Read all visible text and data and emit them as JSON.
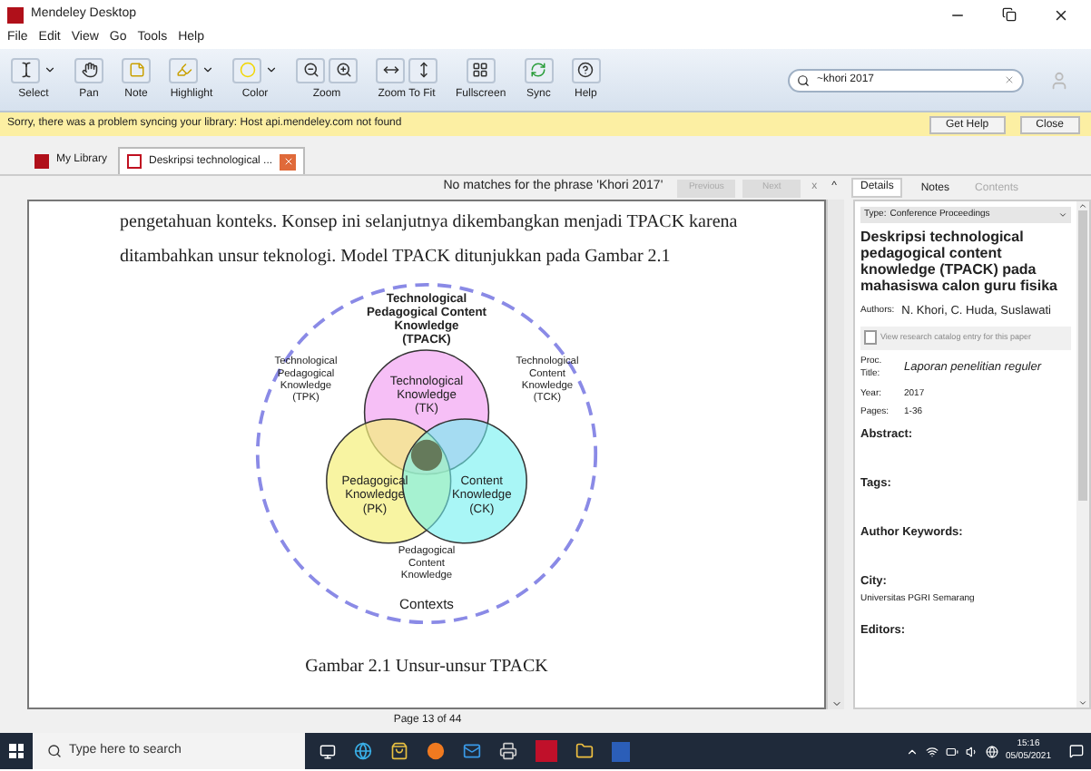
{
  "window": {
    "title": "Mendeley Desktop"
  },
  "menu": [
    "File",
    "Edit",
    "View",
    "Go",
    "Tools",
    "Help"
  ],
  "toolbar": [
    {
      "label": "Select",
      "has_menu": true
    },
    {
      "label": "Pan",
      "has_menu": false
    },
    {
      "label": "Note",
      "has_menu": false
    },
    {
      "label": "Highlight",
      "has_menu": true
    },
    {
      "label": "Color",
      "has_menu": true
    },
    {
      "label": "Zoom",
      "has_menu": false
    },
    {
      "label": "Zoom To Fit",
      "has_menu": false
    },
    {
      "label": "Fullscreen",
      "has_menu": false
    },
    {
      "label": "Sync",
      "has_menu": false
    },
    {
      "label": "Help",
      "has_menu": false
    }
  ],
  "search": {
    "value": "~khori 2017"
  },
  "notification": {
    "message": "Sorry, there was a problem syncing your library: Host api.mendeley.com not found",
    "buttons": [
      "Get Help",
      "Close"
    ]
  },
  "tabs": [
    {
      "label": "My Library",
      "selected": false,
      "closable": false
    },
    {
      "label": "Deskripsi technological ...",
      "selected": true,
      "closable": true
    }
  ],
  "find_bar": {
    "message": "No matches for the phrase 'Khori 2017'",
    "buttons": [
      {
        "label": "Previous",
        "disabled": true
      },
      {
        "label": "Next",
        "disabled": true
      }
    ],
    "close": "x",
    "collapse": "^"
  },
  "document": {
    "lines": [
      "pengetahuan konteks. Konsep ini selanjutnya dikembangkan menjadi TPACK karena",
      "ditambahkan unsur teknologi. Model TPACK ditunjukkan pada Gambar 2.1"
    ],
    "figure_labels": [
      [
        "Technological",
        "Pedagogical Content",
        "Knowledge",
        "(TPACK)"
      ],
      [
        "Technological",
        "Pedagogical",
        "Knowledge",
        "(TPK)"
      ],
      [
        "Technological",
        "Knowledge",
        "(TK)"
      ],
      [
        "Technological",
        "Content",
        "Knowledge",
        "(TCK)"
      ],
      [
        "Pedagogical",
        "Knowledge",
        "(PK)"
      ],
      [
        "Content",
        "Knowledge",
        "(CK)"
      ],
      [
        "Pedagogical",
        "Content",
        "Knowledge"
      ],
      [
        "Contexts"
      ]
    ],
    "caption": "Gambar 2.1 Unsur-unsur TPACK",
    "page": "Page 13 of 44"
  },
  "panel_tabs": [
    {
      "label": "Details",
      "selected": true,
      "disabled": false
    },
    {
      "label": "Notes",
      "selected": false,
      "disabled": false
    },
    {
      "label": "Contents",
      "selected": false,
      "disabled": true
    }
  ],
  "details": {
    "type_label": "Type:",
    "type_value": "Conference Proceedings",
    "title": "Deskripsi technological pedagogical content knowledge (TPACK) pada mahasiswa calon guru fisika",
    "authors_label": "Authors:",
    "authors": "N. Khori, C. Huda, Suslawati",
    "catalog_button": "View research catalog entry for this paper",
    "fields": [
      {
        "label": "Proc. Title:",
        "value": "Laporan penelitian reguler",
        "italic": true
      },
      {
        "label": "Year:",
        "value": "2017",
        "italic": false
      },
      {
        "label": "Pages:",
        "value": "1-36",
        "italic": false
      }
    ],
    "sections": [
      {
        "heading": "Abstract:"
      },
      {
        "heading": "Tags:"
      },
      {
        "heading": "Author Keywords:"
      },
      {
        "heading": "City:",
        "value": "Universitas PGRI Semarang"
      },
      {
        "heading": "Editors:"
      }
    ]
  },
  "taskbar": {
    "search_placeholder": "Type here to search",
    "time": "15:16",
    "date": "05/05/2021"
  }
}
